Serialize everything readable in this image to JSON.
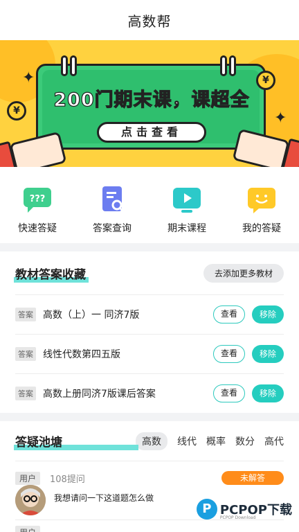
{
  "header": {
    "title": "高数帮"
  },
  "banner": {
    "headline": "200门期末课，课超全",
    "cta": "点击查看",
    "coin_symbol": "¥"
  },
  "quick_actions": [
    {
      "label": "快速答疑",
      "icon": "question-bubble-icon",
      "color": "#3fcf8e"
    },
    {
      "label": "答案查询",
      "icon": "search-document-icon",
      "color": "#6c7df0"
    },
    {
      "label": "期末课程",
      "icon": "video-play-icon",
      "color": "#2cc9c9"
    },
    {
      "label": "我的答疑",
      "icon": "smile-bubble-icon",
      "color": "#ffc928"
    }
  ],
  "textbooks": {
    "title": "教材答案收藏",
    "add_more": "去添加更多教材",
    "items": [
      {
        "tag": "答案",
        "name": "高数（上）一 同济7版",
        "view": "查看",
        "remove": "移除"
      },
      {
        "tag": "答案",
        "name": "线性代数第四五版",
        "view": "查看",
        "remove": "移除"
      },
      {
        "tag": "答案",
        "name": "高数上册同济7版课后答案",
        "view": "查看",
        "remove": "移除"
      }
    ]
  },
  "qa": {
    "title": "答疑池塘",
    "tabs": [
      "高数",
      "线代",
      "概率",
      "数分",
      "高代"
    ],
    "active_tab": "高数",
    "items": [
      {
        "user_tag": "用户",
        "count": "108提问",
        "status": "未解答",
        "question": "我想请问一下这道题怎么做"
      }
    ]
  },
  "watermark": {
    "logo": "P",
    "text": "PCPOP下载",
    "sub": "PCPOP Download"
  },
  "colors": {
    "accent": "#25cdbf",
    "orange": "#ff8c1a",
    "banner": "#ffd23f",
    "banner_card": "#2fbf6e"
  }
}
